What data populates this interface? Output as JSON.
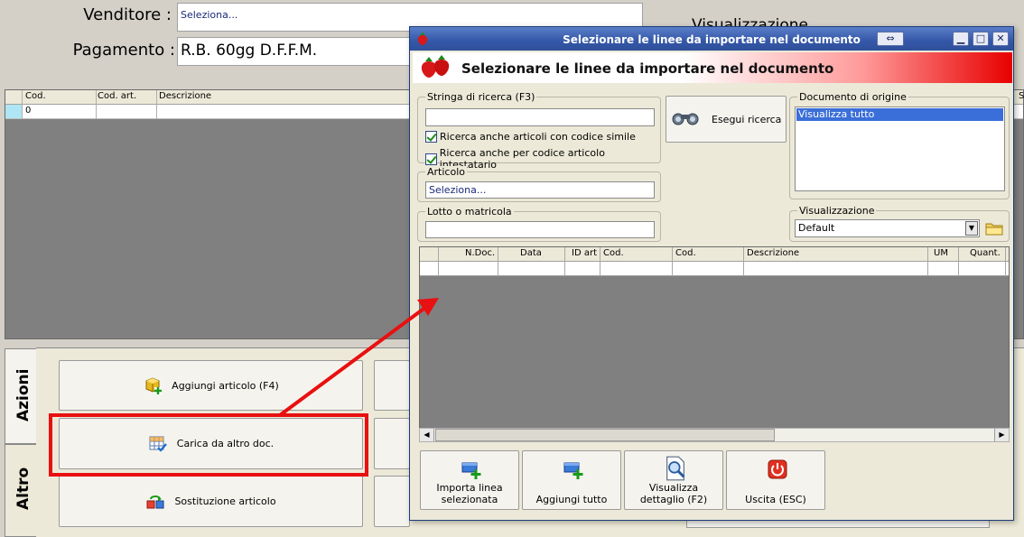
{
  "form": {
    "vendor_label": "Venditore :",
    "vendor_value": "Seleziona...",
    "payment_label": "Pagamento :",
    "payment_value": "R.B. 60gg D.F.F.M.",
    "partial_right_label": "Visualizzazione"
  },
  "main_grid": {
    "headers": [
      "Cod.",
      "Cod. art.",
      "Descrizione"
    ],
    "row": [
      "0",
      "",
      ""
    ],
    "right_partial_header": "S"
  },
  "tabs": {
    "azioni": "Azioni",
    "altro": "Altro"
  },
  "actions": {
    "add_article": "Aggiungi articolo (F4)",
    "load_other_doc": "Carica da altro doc.",
    "replace_article": "Sostituzione articolo"
  },
  "dialog": {
    "title": "Selezionare le linee da importare nel documento",
    "banner": "Selezionare le linee da importare nel documento",
    "search_group": "Stringa di ricerca (F3)",
    "search_value": "",
    "chk_similar": "Ricerca anche articoli con codice simile",
    "chk_holder_code": "Ricerca anche per codice articolo intestatario",
    "search_button": "Esegui ricerca",
    "article_group": "Articolo",
    "article_value": "Seleziona...",
    "lot_group": "Lotto o matricola",
    "lot_value": "",
    "origin_group": "Documento di origine",
    "origin_item": "Visualizza tutto",
    "view_group": "Visualizzazione",
    "view_value": "Default",
    "table_headers": [
      "N.Doc.",
      "Data",
      "ID art",
      "Cod.",
      "Cod.",
      "Descrizione",
      "UM",
      "Quant."
    ],
    "buttons": {
      "import": "Importa linea selezionata",
      "add_all": "Aggiungi tutto",
      "view_detail": "Visualizza dettaglio (F2)",
      "exit": "Uscita (ESC)"
    }
  },
  "colors": {
    "highlight_red": "#e81010",
    "title_blue": "#3457a8",
    "selection_blue": "#3a6ed8"
  }
}
